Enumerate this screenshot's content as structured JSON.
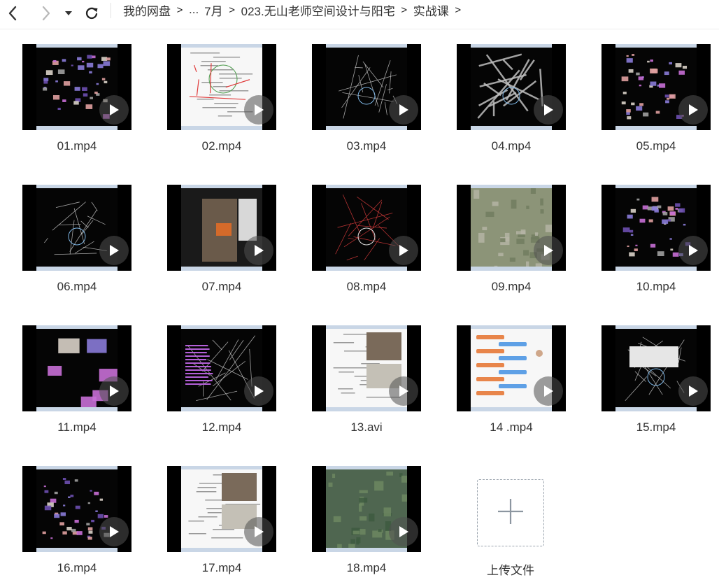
{
  "toolbar": {
    "icons": {
      "back": "chevron-left-icon",
      "forward": "chevron-right-icon",
      "history": "caret-down-icon",
      "refresh": "refresh-icon"
    }
  },
  "breadcrumb": {
    "items": [
      "我的网盘",
      "...",
      "7月",
      "023.无山老师空间设计与阳宅",
      "实战课"
    ],
    "separator": ">"
  },
  "files": [
    {
      "name": "01.mp4",
      "theme": "dark-scatter"
    },
    {
      "name": "02.mp4",
      "theme": "white-plan"
    },
    {
      "name": "03.mp4",
      "theme": "dark-cad"
    },
    {
      "name": "04.mp4",
      "theme": "dark-walls"
    },
    {
      "name": "05.mp4",
      "theme": "dark-scatter"
    },
    {
      "name": "06.mp4",
      "theme": "dark-cad"
    },
    {
      "name": "07.mp4",
      "theme": "photo-room"
    },
    {
      "name": "08.mp4",
      "theme": "dark-red-cad"
    },
    {
      "name": "09.mp4",
      "theme": "aerial"
    },
    {
      "name": "10.mp4",
      "theme": "dark-scatter"
    },
    {
      "name": "11.mp4",
      "theme": "dark-photos"
    },
    {
      "name": "12.mp4",
      "theme": "dark-text"
    },
    {
      "name": "13.avi",
      "theme": "white-doc"
    },
    {
      "name": "14 .mp4",
      "theme": "chat"
    },
    {
      "name": "15.mp4",
      "theme": "dark-dialog"
    },
    {
      "name": "16.mp4",
      "theme": "dark-scatter"
    },
    {
      "name": "17.mp4",
      "theme": "white-doc"
    },
    {
      "name": "18.mp4",
      "theme": "aerial-green"
    }
  ],
  "upload": {
    "label": "上传文件",
    "icon": "plus-icon"
  },
  "colors": {
    "text": "#333333",
    "thumb_bg": "#000000",
    "play_overlay": "#505050",
    "upload_border": "#9aa3ad"
  }
}
